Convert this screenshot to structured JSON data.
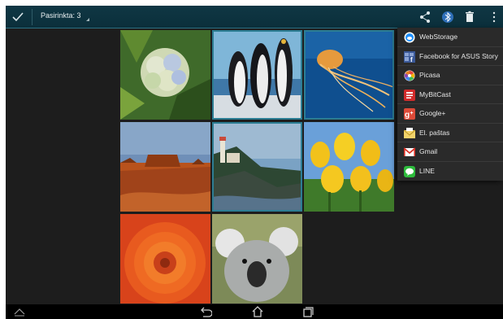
{
  "action_bar": {
    "selection_label": "Pasirinkta: 3",
    "icons": [
      "check-icon",
      "share-icon",
      "bluetooth-icon",
      "trash-icon",
      "overflow-menu-icon"
    ]
  },
  "gallery": {
    "tiles": [
      {
        "name": "hydrangea-photo",
        "selected": false
      },
      {
        "name": "penguins-photo",
        "selected": true
      },
      {
        "name": "jellyfish-photo",
        "selected": true
      },
      {
        "name": "desert-photo",
        "selected": false
      },
      {
        "name": "lighthouse-photo",
        "selected": true
      },
      {
        "name": "tulips-photo",
        "selected": false
      },
      {
        "name": "chrysanthemum-photo",
        "selected": false
      },
      {
        "name": "koala-photo",
        "selected": false
      }
    ]
  },
  "share_menu": {
    "items": [
      {
        "label": "WebStorage",
        "icon": "webstorage-icon",
        "color": "#1e90ff"
      },
      {
        "label": "Facebook for ASUS Story",
        "icon": "facebook-icon",
        "color": "#3b5998"
      },
      {
        "label": "Picasa",
        "icon": "picasa-icon",
        "color": "#e6493b"
      },
      {
        "label": "MyBitCast",
        "icon": "mybitcast-icon",
        "color": "#d22b2b"
      },
      {
        "label": "Google+",
        "icon": "googleplus-icon",
        "color": "#dd4b39"
      },
      {
        "label": "El. paštas",
        "icon": "email-icon",
        "color": "#e8c23a"
      },
      {
        "label": "Gmail",
        "icon": "gmail-icon",
        "color": "#d93025"
      },
      {
        "label": "LINE",
        "icon": "line-icon",
        "color": "#2dbb3c"
      }
    ]
  },
  "nav_bar": {
    "icons": [
      "up-chevron-icon",
      "back-icon",
      "home-icon",
      "recent-apps-icon"
    ]
  }
}
